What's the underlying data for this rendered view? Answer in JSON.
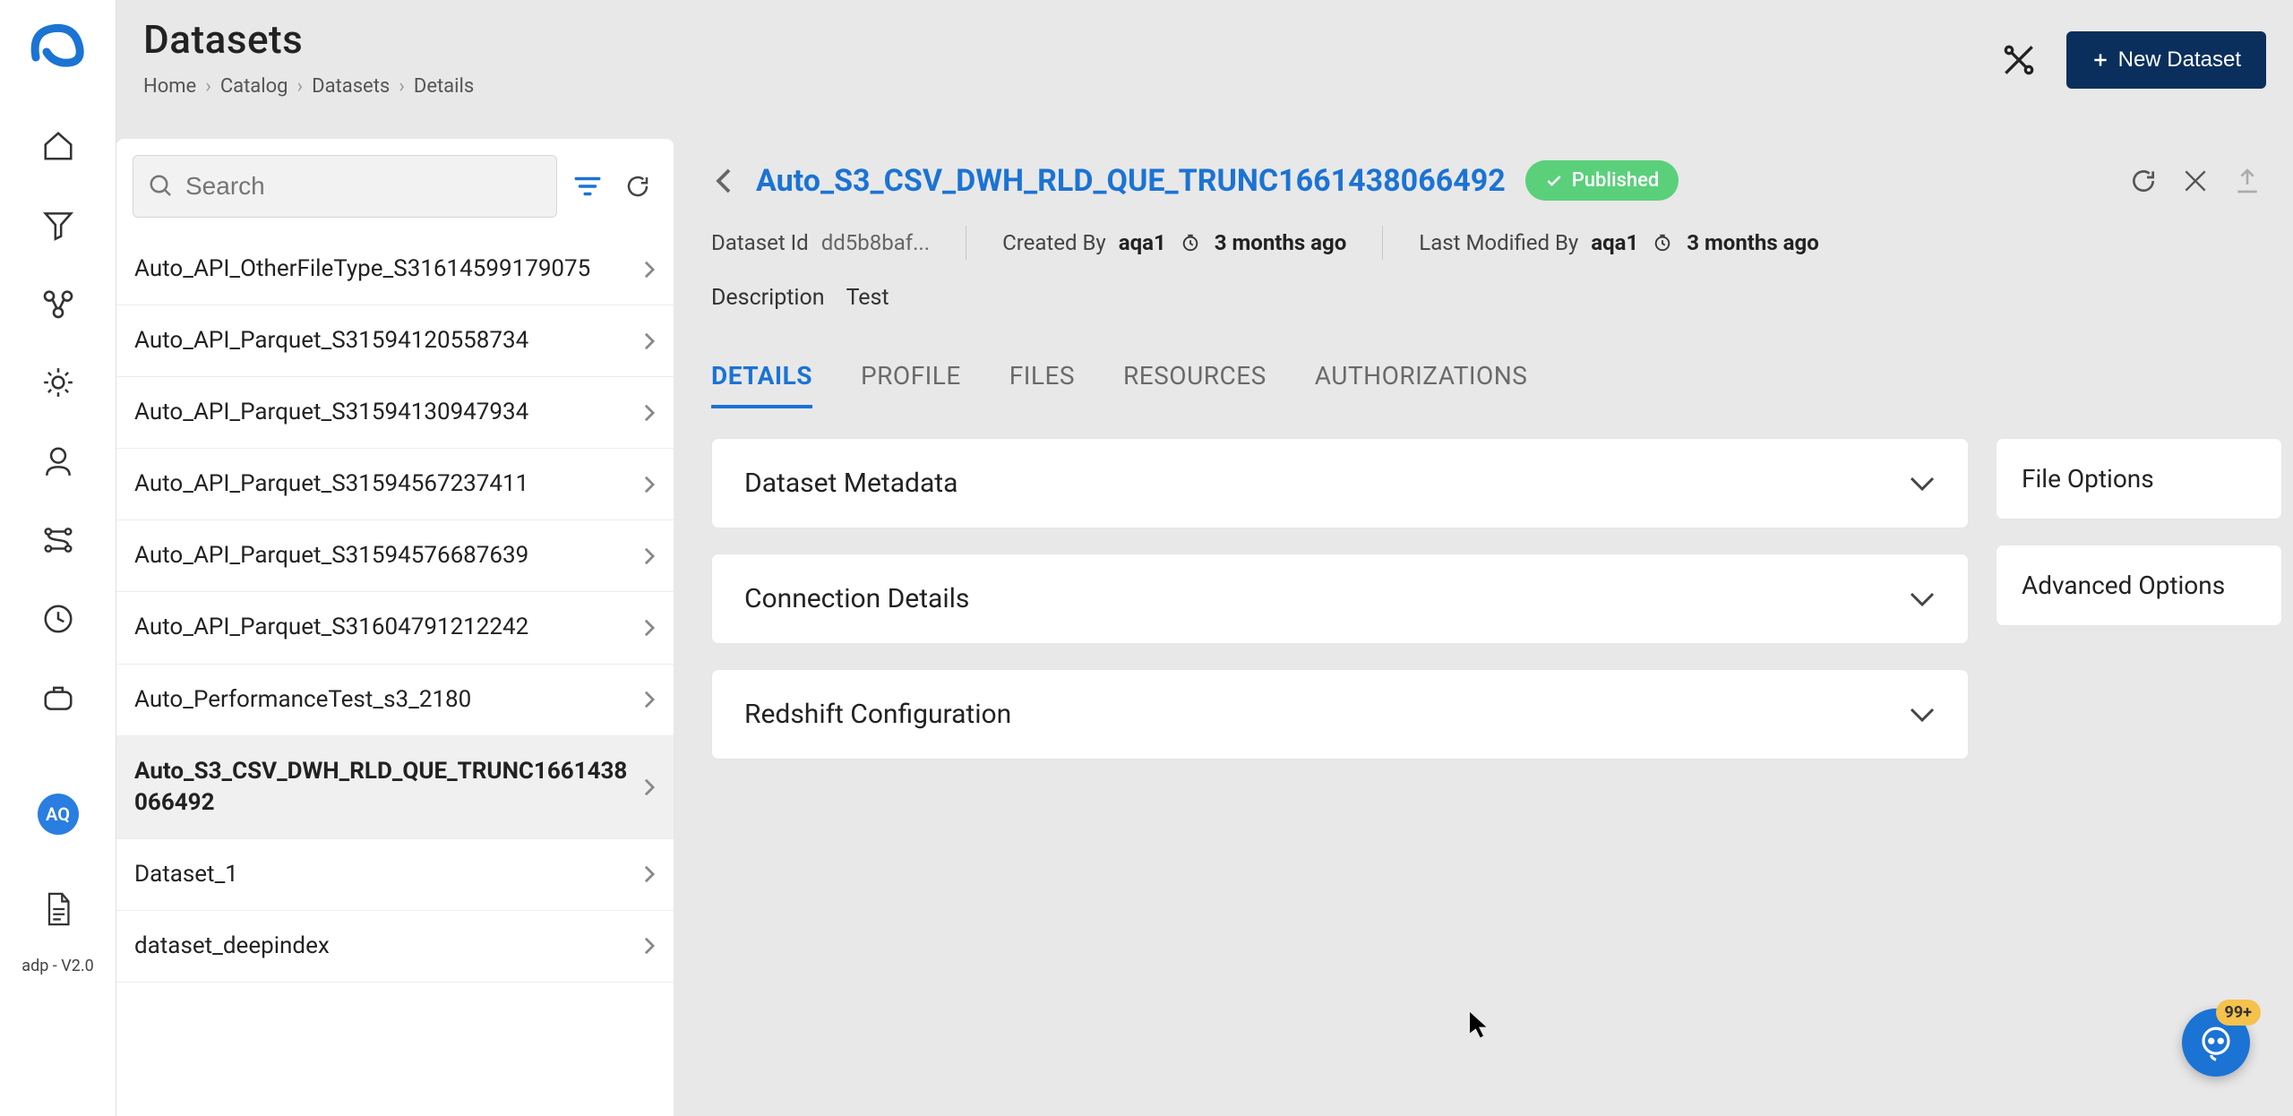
{
  "page_title": "Datasets",
  "breadcrumb": [
    "Home",
    "Catalog",
    "Datasets",
    "Details"
  ],
  "top_actions": {
    "new_dataset_label": "New Dataset"
  },
  "nav": {
    "avatar": "AQ",
    "version": "adp - V2.0"
  },
  "search": {
    "placeholder": "Search"
  },
  "dataset_list": [
    {
      "name": "Auto_API_OtherFileType_S31614599179075",
      "selected": false
    },
    {
      "name": "Auto_API_Parquet_S31594120558734",
      "selected": false
    },
    {
      "name": "Auto_API_Parquet_S31594130947934",
      "selected": false
    },
    {
      "name": "Auto_API_Parquet_S31594567237411",
      "selected": false
    },
    {
      "name": "Auto_API_Parquet_S31594576687639",
      "selected": false
    },
    {
      "name": "Auto_API_Parquet_S31604791212242",
      "selected": false
    },
    {
      "name": "Auto_PerformanceTest_s3_2180",
      "selected": false
    },
    {
      "name": "Auto_S3_CSV_DWH_RLD_QUE_TRUNC1661438066492",
      "selected": true
    },
    {
      "name": "Dataset_1",
      "selected": false
    },
    {
      "name": "dataset_deepindex",
      "selected": false
    }
  ],
  "details": {
    "title": "Auto_S3_CSV_DWH_RLD_QUE_TRUNC1661438066492",
    "status": "Published",
    "dataset_id_label": "Dataset Id",
    "dataset_id": "dd5b8baf...",
    "created_by_label": "Created By",
    "created_by_user": "aqa1",
    "created_by_time": "3 months ago",
    "modified_by_label": "Last Modified By",
    "modified_by_user": "aqa1",
    "modified_by_time": "3 months ago",
    "description_label": "Description",
    "description": "Test"
  },
  "tabs": [
    "DETAILS",
    "PROFILE",
    "FILES",
    "RESOURCES",
    "AUTHORIZATIONS"
  ],
  "active_tab": "DETAILS",
  "accordions": [
    "Dataset Metadata",
    "Connection Details",
    "Redshift Configuration"
  ],
  "side_cards": [
    "File Options",
    "Advanced Options"
  ],
  "chat_badge": "99+"
}
